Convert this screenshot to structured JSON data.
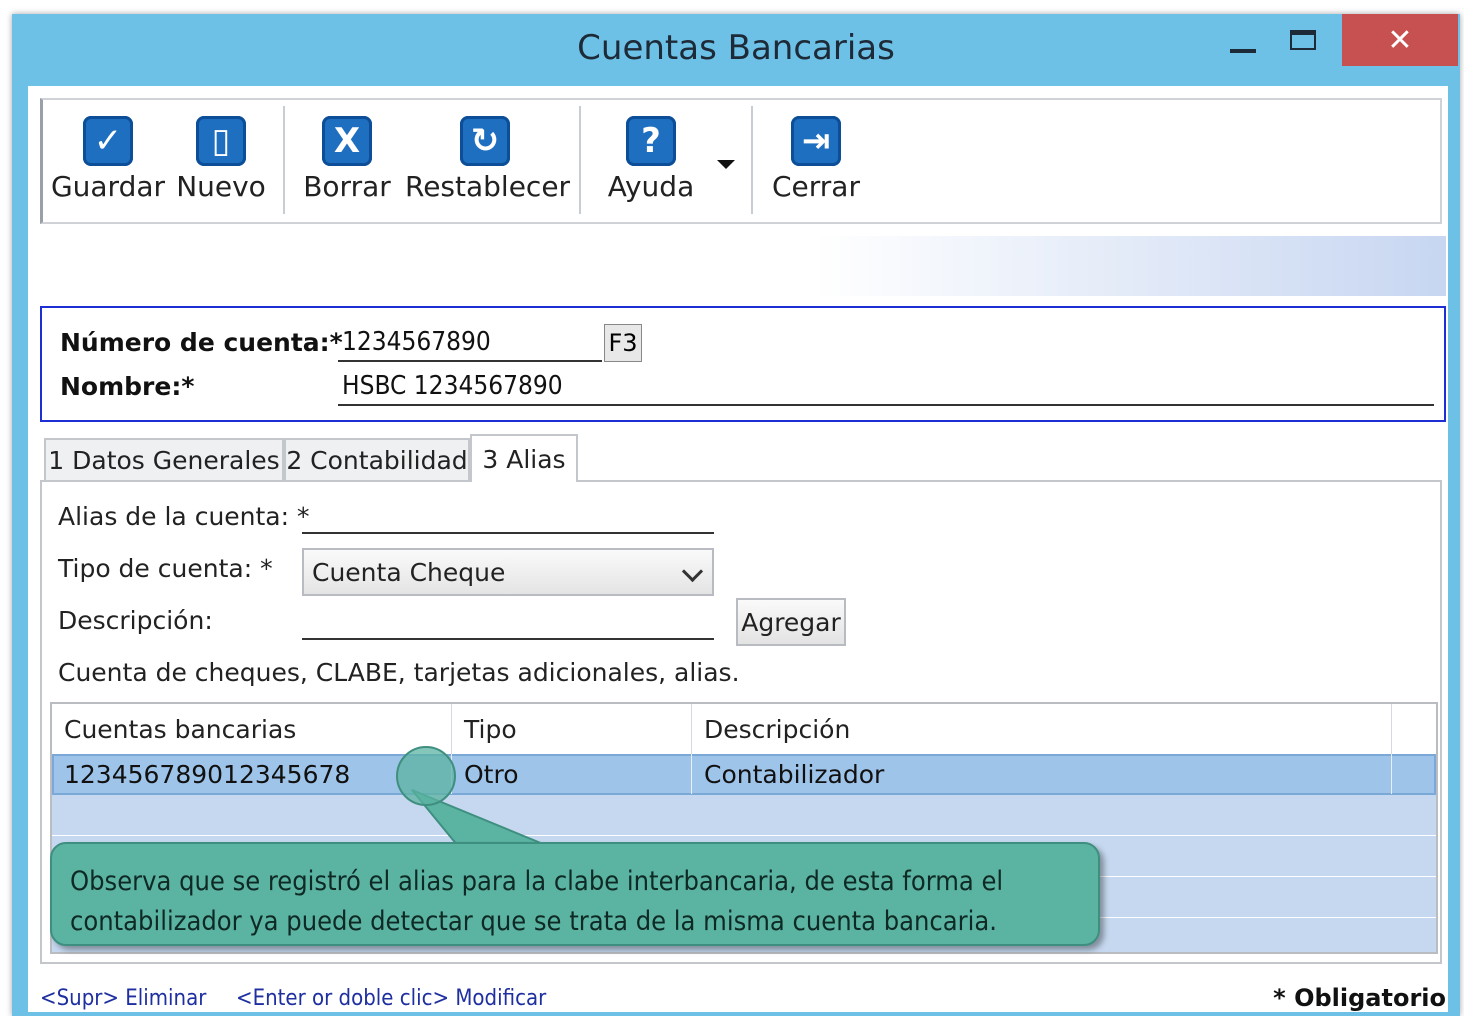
{
  "window": {
    "title": "Cuentas Bancarias",
    "minimize_icon": "minimize-icon",
    "maximize_icon": "maximize-icon",
    "close_glyph": "✕"
  },
  "toolbar": {
    "items": [
      {
        "label": "Guardar",
        "icon": "checkbox-check-icon",
        "glyph": "✓"
      },
      {
        "label": "Nuevo",
        "icon": "new-document-icon",
        "glyph": "▯"
      },
      {
        "label": "Borrar",
        "icon": "delete-x-icon",
        "glyph": "X"
      },
      {
        "label": "Restablecer",
        "icon": "refresh-icon",
        "glyph": "↻"
      },
      {
        "label": "Ayuda",
        "icon": "help-question-icon",
        "glyph": "?"
      },
      {
        "label": "Cerrar",
        "icon": "exit-door-icon",
        "glyph": "⇥"
      }
    ]
  },
  "header": {
    "numero_label": "Número de cuenta:*",
    "numero_value": "1234567890",
    "f3_label": "F3",
    "nombre_label": "Nombre:*",
    "nombre_value": "HSBC 1234567890"
  },
  "tabs": [
    {
      "label": "1 Datos Generales"
    },
    {
      "label": "2 Contabilidad"
    },
    {
      "label": "3 Alias"
    }
  ],
  "alias_form": {
    "alias_label": "Alias de la cuenta: *",
    "alias_value": "",
    "tipo_label": "Tipo de cuenta: *",
    "tipo_value": "Cuenta Cheque",
    "descripcion_label": "Descripción:",
    "descripcion_value": "",
    "agregar_label": "Agregar",
    "hint": "Cuenta de cheques, CLABE, tarjetas adicionales, alias."
  },
  "grid": {
    "columns": [
      "Cuentas bancarias",
      "Tipo",
      "Descripción"
    ],
    "rows": [
      [
        "123456789012345678",
        "Otro",
        "Contabilizador"
      ]
    ]
  },
  "callout": {
    "text": "Observa que se registró el alias para la clabe interbancaria, de esta forma el contabilizador ya puede detectar que se trata de la misma cuenta bancaria."
  },
  "status": {
    "delete_hint": "<Supr> Eliminar",
    "modify_hint": "<Enter or doble clic> Modificar",
    "required_note": "* Obligatorio"
  },
  "colors": {
    "window_frame": "#6ec1e6",
    "close_button": "#c75050",
    "toolbar_icon": "#1f6fc0",
    "selected_row": "#9fc4ea",
    "callout": "#5bb3a2",
    "header_border": "#1d2fd4"
  }
}
